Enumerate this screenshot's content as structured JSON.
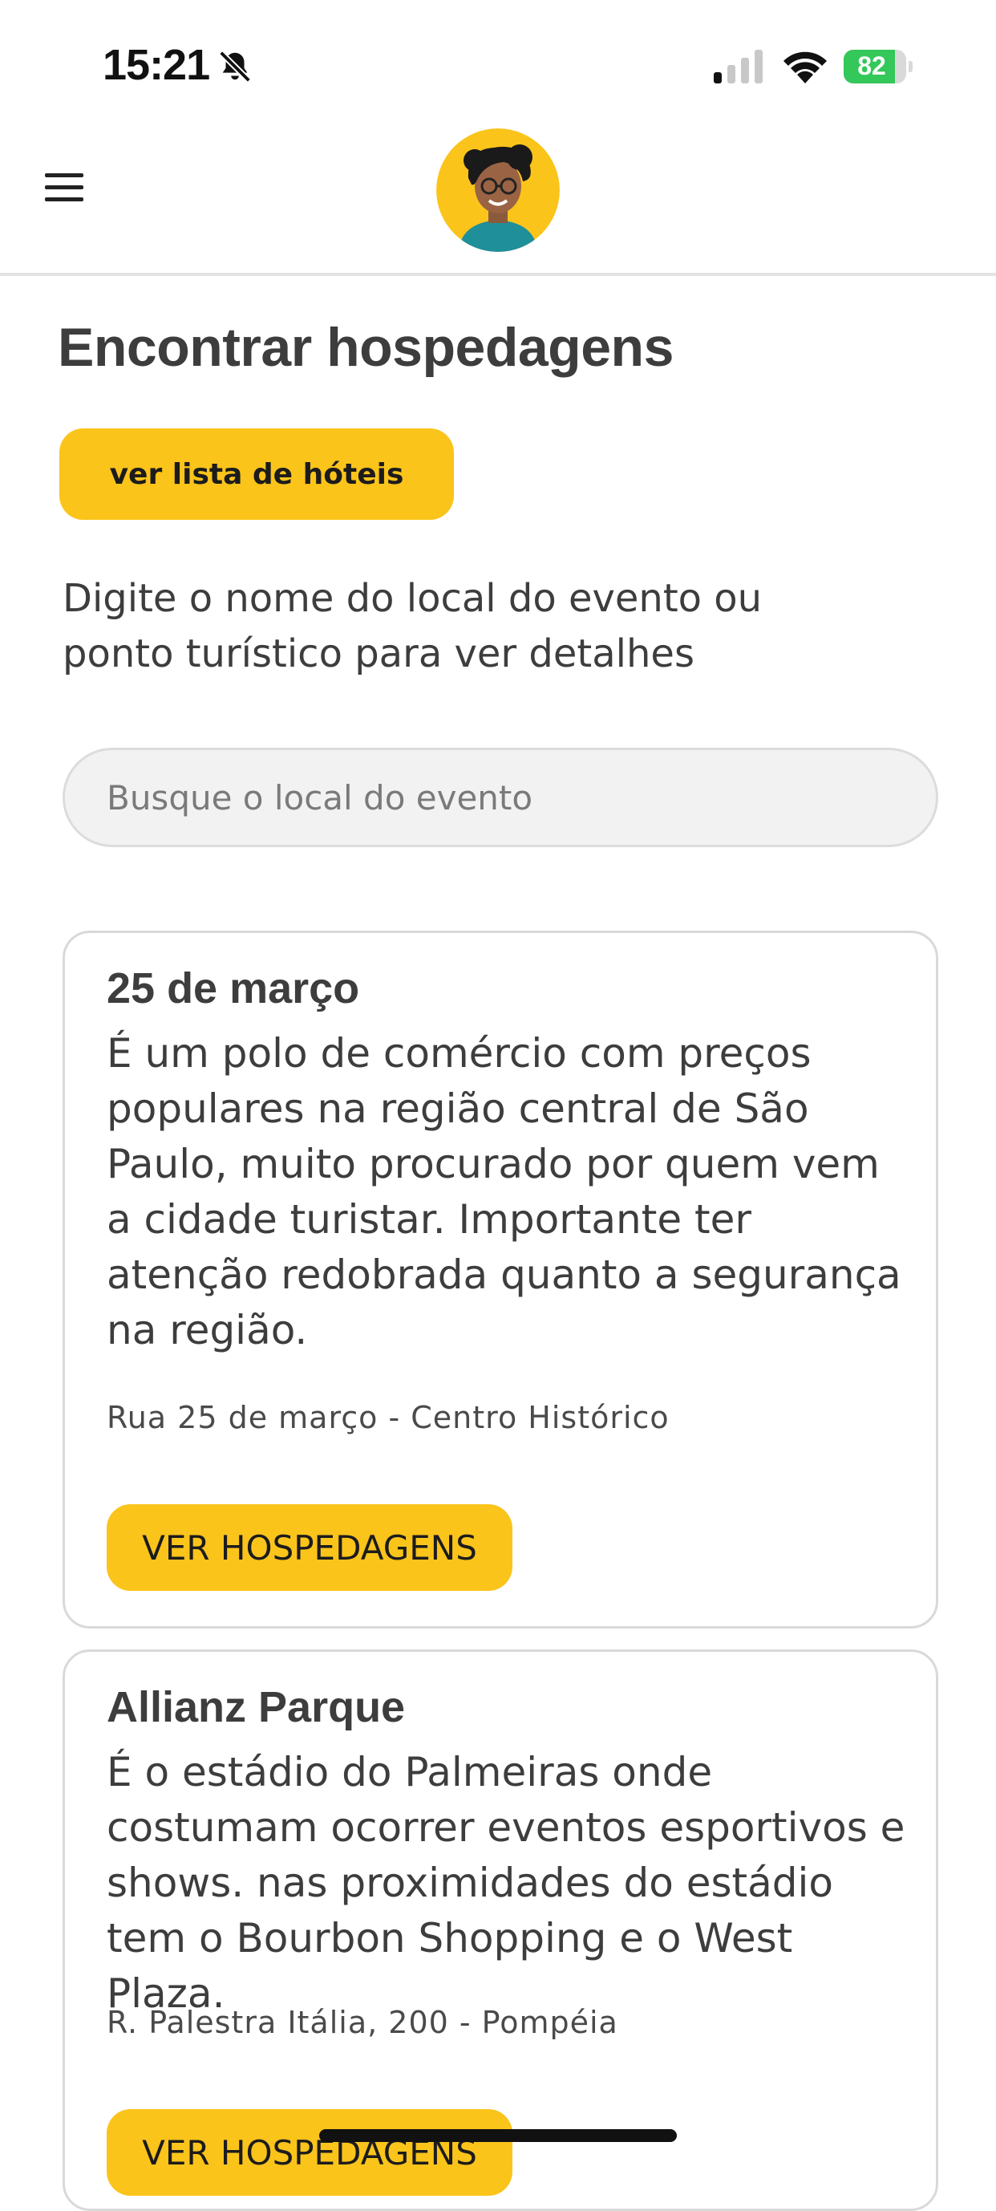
{
  "status_bar": {
    "time": "15:21",
    "battery": "82",
    "battery_level_percent": 82,
    "icons": [
      "bell-slash-icon",
      "cellular-signal-icon",
      "wifi-icon",
      "battery-charging-icon"
    ]
  },
  "header": {
    "menu_icon": "hamburger-menu-icon",
    "avatar": "user-avatar"
  },
  "page": {
    "title": "Encontrar hospedagens",
    "hotel_list_button": "ver lista de hóteis",
    "instructions": "Digite o nome do local do evento ou ponto turístico para ver detalhes",
    "search_placeholder": "Busque o local do evento"
  },
  "places": [
    {
      "name": "25 de março",
      "description": "É um polo de comércio com preços populares na região central de São Paulo, muito procurado por quem vem a cidade turistar. Importante ter atenção redobrada quanto a segurança na região.",
      "address": "Rua 25 de março - Centro Histórico",
      "button": "VER HOSPEDAGENS"
    },
    {
      "name": "Allianz Parque",
      "description": "É o estádio do Palmeiras onde costumam ocorrer eventos esportivos e shows. nas proximidades do estádio tem o Bourbon Shopping e o West Plaza.",
      "address": "R. Palestra Itália, 200 - Pompéia",
      "button": "VER HOSPEDAGENS"
    }
  ],
  "colors": {
    "accent": "#fbc41b",
    "text": "#3d3d3d",
    "card_border": "#d9d9d9",
    "battery_green": "#34c759"
  }
}
